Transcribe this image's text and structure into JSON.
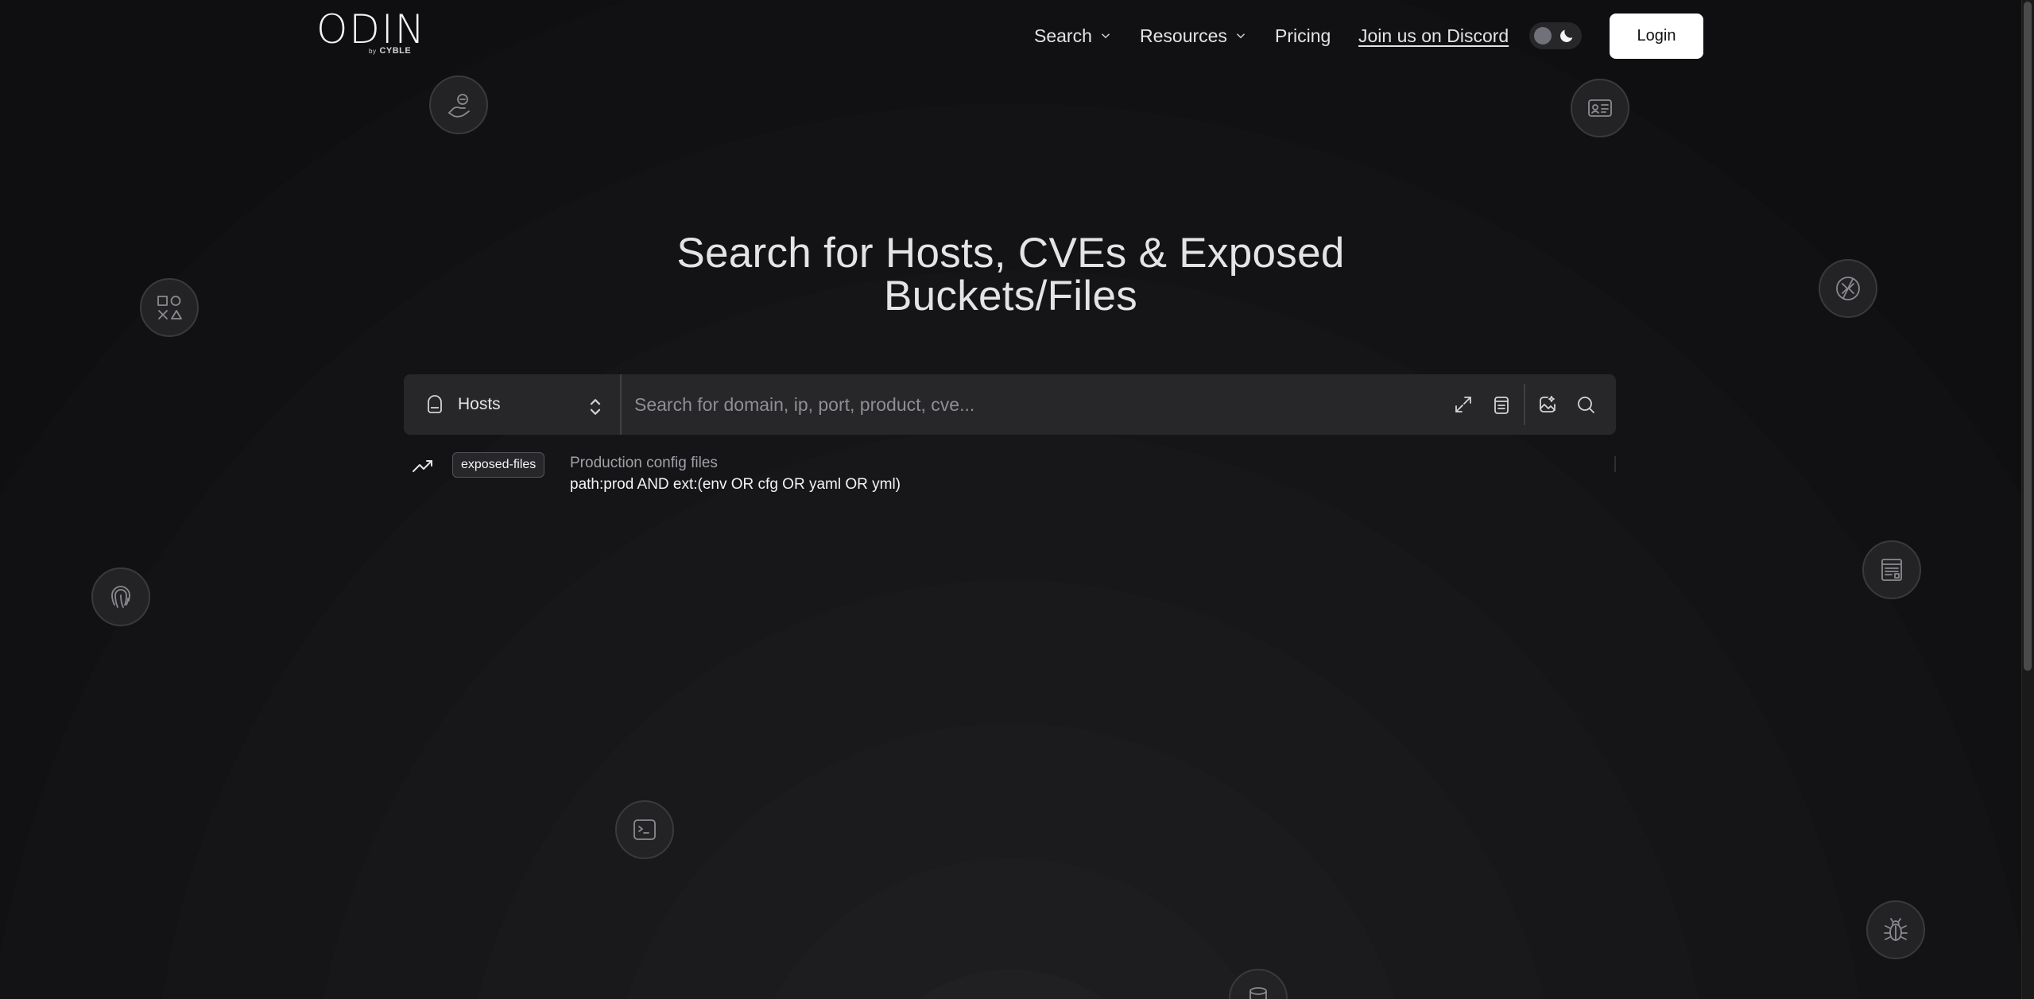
{
  "logo": {
    "word": "ODIN",
    "by": "by",
    "brand": "CYBLE"
  },
  "nav": {
    "search": "Search",
    "resources": "Resources",
    "pricing": "Pricing",
    "discord": "Join us on Discord",
    "login": "Login"
  },
  "hero": {
    "line1": "Search for Hosts, CVEs & Exposed",
    "line2": "Buckets/Files"
  },
  "search": {
    "type_label": "Hosts",
    "placeholder": "Search for domain, ip, port, product, cve..."
  },
  "suggestion": {
    "tag": "exposed-files",
    "title": "Production config files",
    "query": "path:prod AND ext:(env OR cfg OR yaml OR yml)"
  },
  "icons": {
    "floating": [
      "hand-coin-icon",
      "id-card-icon",
      "shapes-icon",
      "remote-desktop-icon",
      "fingerprint-icon",
      "browser-window-icon",
      "terminal-icon",
      "bug-icon",
      "database-icon"
    ],
    "search_bar": [
      "expand-icon",
      "clipboard-icon",
      "image-search-icon",
      "search-icon"
    ]
  },
  "colors": {
    "background": "#111113",
    "accent": "#ffffff",
    "surface": "#27272a"
  }
}
